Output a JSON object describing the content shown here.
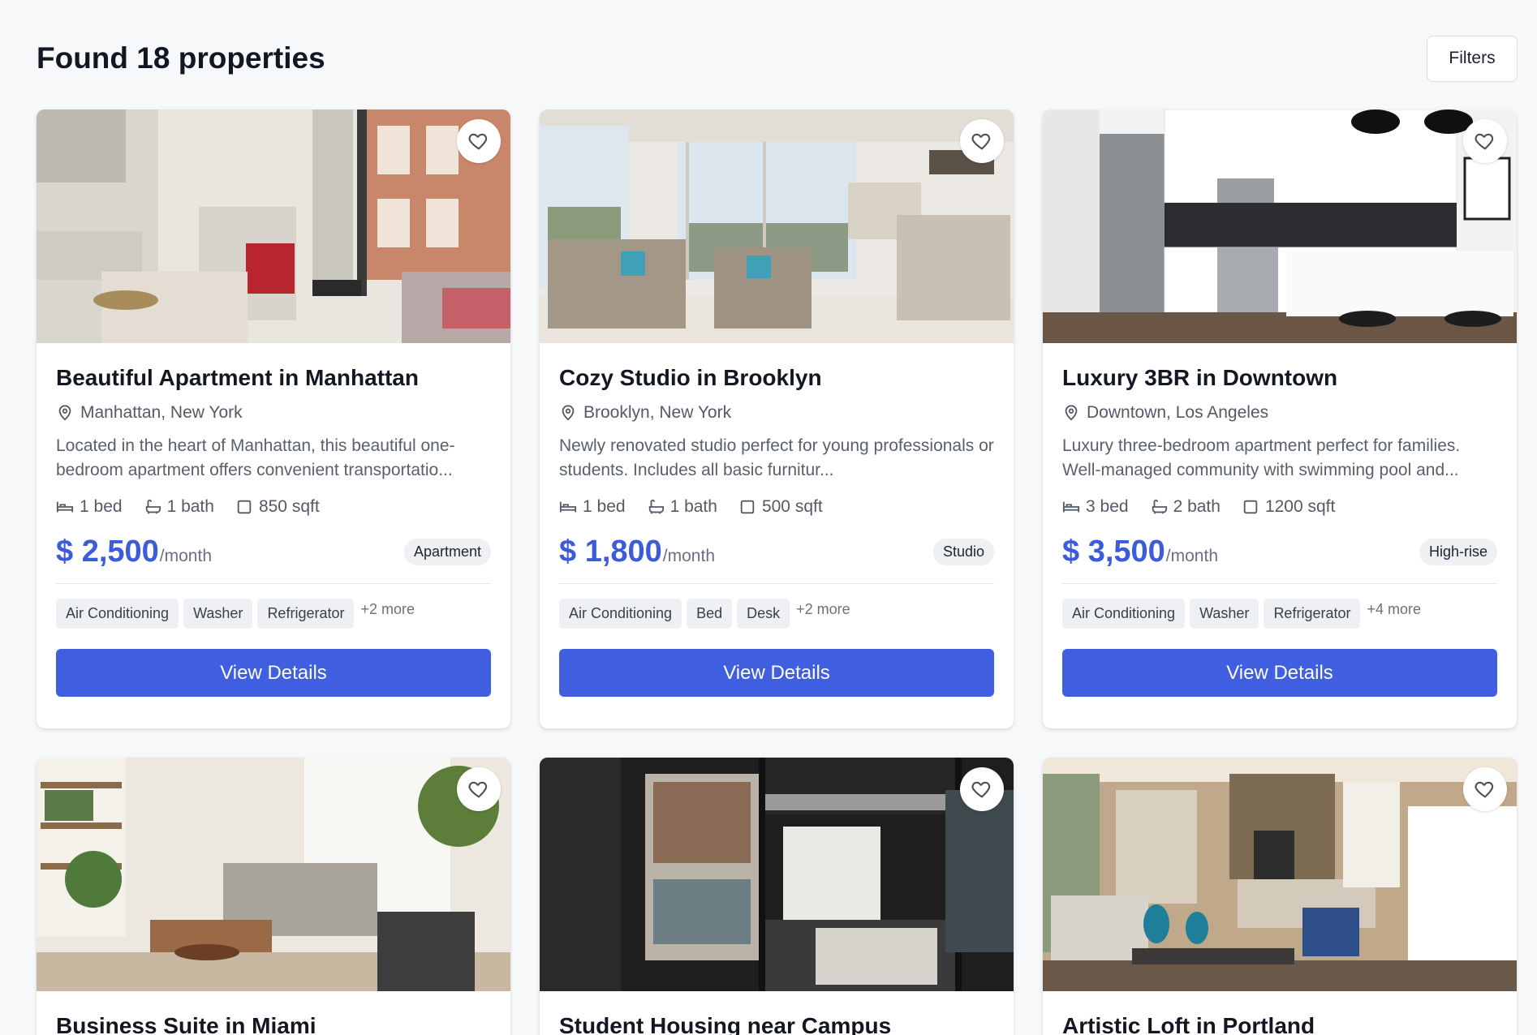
{
  "header": {
    "title": "Found 18 properties",
    "filters_label": "Filters"
  },
  "listings": [
    {
      "title": "Beautiful Apartment in Manhattan",
      "location": "Manhattan, New York",
      "description": "Located in the heart of Manhattan, this beautiful one-bedroom apartment offers convenient transportatio...",
      "beds": "1 bed",
      "baths": "1 bath",
      "area": "850 sqft",
      "price": "$ 2,500",
      "price_unit": "/month",
      "type": "Apartment",
      "amenities": [
        "Air Conditioning",
        "Washer",
        "Refrigerator"
      ],
      "more": "+2 more",
      "button": "View Details"
    },
    {
      "title": "Cozy Studio in Brooklyn",
      "location": "Brooklyn, New York",
      "description": "Newly renovated studio perfect for young professionals or students. Includes all basic furnitur...",
      "beds": "1 bed",
      "baths": "1 bath",
      "area": "500 sqft",
      "price": "$ 1,800",
      "price_unit": "/month",
      "type": "Studio",
      "amenities": [
        "Air Conditioning",
        "Bed",
        "Desk"
      ],
      "more": "+2 more",
      "button": "View Details"
    },
    {
      "title": "Luxury 3BR in Downtown",
      "location": "Downtown, Los Angeles",
      "description": "Luxury three-bedroom apartment perfect for families. Well-managed community with swimming pool and...",
      "beds": "3 bed",
      "baths": "2 bath",
      "area": "1200 sqft",
      "price": "$ 3,500",
      "price_unit": "/month",
      "type": "High-rise",
      "amenities": [
        "Air Conditioning",
        "Washer",
        "Refrigerator"
      ],
      "more": "+4 more",
      "button": "View Details"
    },
    {
      "title": "Business Suite in Miami"
    },
    {
      "title": "Student Housing near Campus"
    },
    {
      "title": "Artistic Loft in Portland"
    }
  ],
  "colors": {
    "accent": "#3f5fe0",
    "price": "#3b5bdb",
    "background": "#f7f8fa"
  },
  "icons": [
    "heart-icon",
    "map-pin-icon",
    "bed-icon",
    "bath-icon",
    "square-icon"
  ]
}
